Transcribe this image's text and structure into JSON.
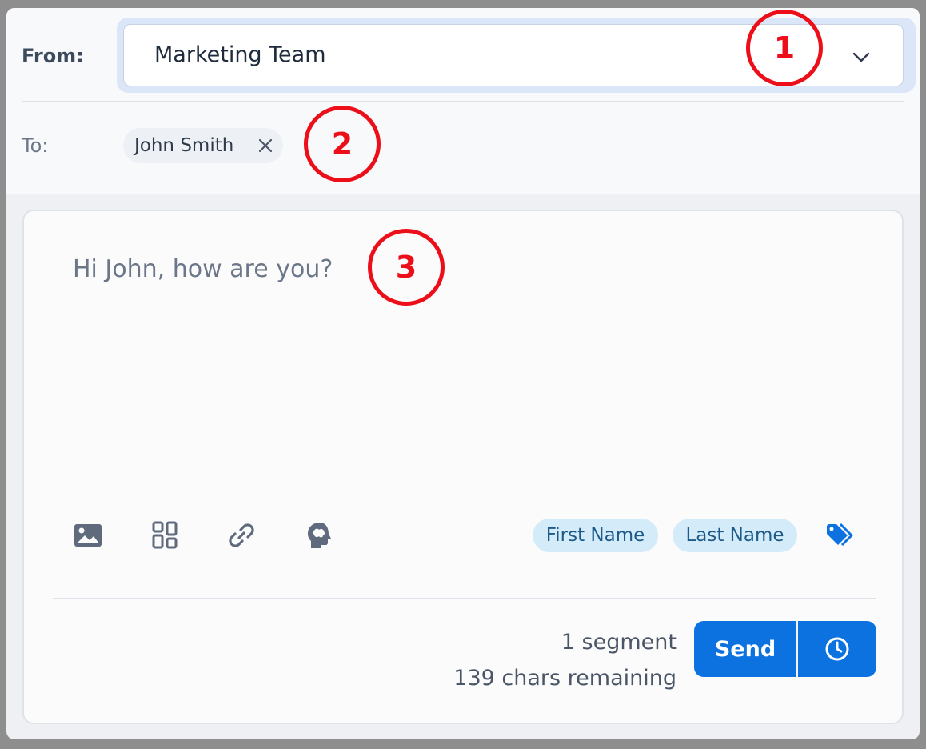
{
  "from": {
    "label": "From:",
    "selected": "Marketing Team"
  },
  "to": {
    "label": "To:",
    "recipients": [
      {
        "name": "John Smith"
      }
    ]
  },
  "composer": {
    "message": "Hi John, how are you?",
    "toolbar": [
      "image-icon",
      "template-grid-icon",
      "link-icon",
      "ai-brain-icon"
    ],
    "merge_tags": [
      "First Name",
      "Last Name"
    ],
    "segment_count": "1 segment",
    "chars_remaining": "139 chars remaining",
    "send_label": "Send"
  },
  "annotations": [
    "1",
    "2",
    "3"
  ],
  "colors": {
    "accent": "#0b72e0",
    "marker": "#ec0f1a",
    "tag_bg": "#d4ecf9"
  }
}
